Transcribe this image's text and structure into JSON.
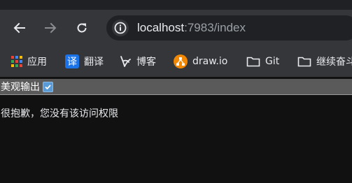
{
  "browser": {
    "url_host": "localhost",
    "url_rest": ":7983/index",
    "bookmarks": [
      {
        "label": "应用",
        "icon": "apps-grid-icon"
      },
      {
        "label": "翻译",
        "icon": "translate-icon"
      },
      {
        "label": "博客",
        "icon": "blog-icon"
      },
      {
        "label": "draw.io",
        "icon": "drawio-icon"
      },
      {
        "label": "Git",
        "icon": "folder-icon"
      },
      {
        "label": "继续奋斗",
        "icon": "folder-icon"
      }
    ],
    "translate_badge": "译"
  },
  "page": {
    "toggle_label": "美观输出",
    "toggle_checked": true,
    "message": "很抱歉，您没有该访问权限"
  },
  "colors": {
    "toolbar": "#35363a",
    "page_background": "#111111",
    "checkbox": "#5b9bd5",
    "drawio": "#f08705"
  }
}
